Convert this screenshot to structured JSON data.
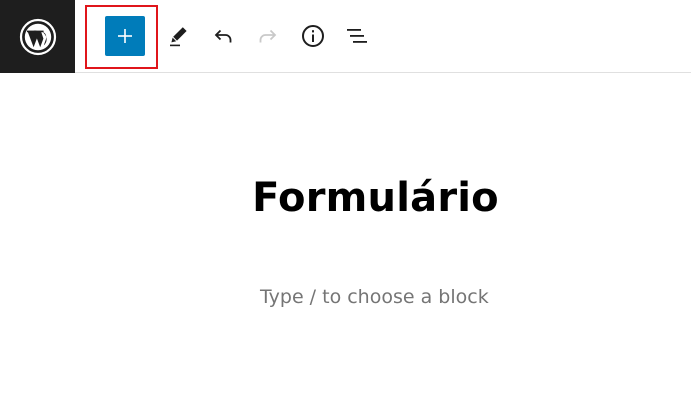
{
  "toolbar": {
    "logo_icon": "wordpress-logo-icon",
    "add_block_icon": "plus-icon",
    "tools_icon": "pencil-icon",
    "undo_icon": "undo-icon",
    "redo_icon": "redo-icon",
    "details_icon": "info-icon",
    "list_view_icon": "list-view-icon",
    "colors": {
      "logo_bg": "#1e1e1e",
      "accent": "#007cba",
      "highlight": "#e0151b",
      "redo_disabled": "#c9c9c9"
    }
  },
  "editor": {
    "title": "Formulário",
    "block_placeholder": "Type / to choose a block"
  }
}
